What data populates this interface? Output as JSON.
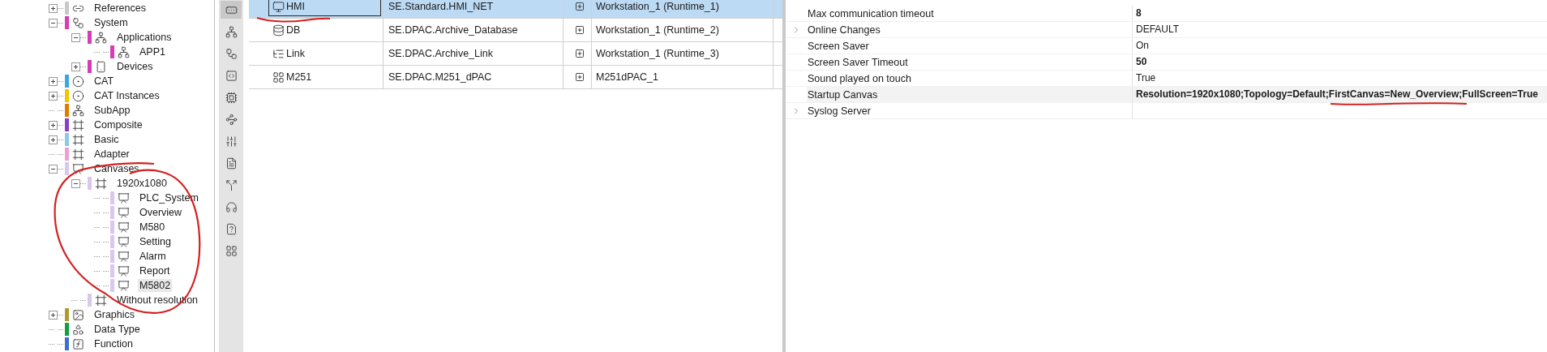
{
  "tree": [
    {
      "label": "References",
      "color": "#c8c8c8",
      "kind": "link",
      "expanded": false
    },
    {
      "label": "System",
      "color": "#d63cb4",
      "kind": "system",
      "expanded": true,
      "children": [
        {
          "label": "Applications",
          "color": "#d63cb4",
          "kind": "app",
          "expanded": true,
          "children": [
            {
              "label": "APP1",
              "color": "#d63cb4",
              "kind": "app"
            }
          ]
        },
        {
          "label": "Devices",
          "color": "#d63cb4",
          "kind": "device",
          "expanded": false
        }
      ]
    },
    {
      "label": "CAT",
      "color": "#3aa8dc",
      "kind": "cat",
      "expanded": false
    },
    {
      "label": "CAT Instances",
      "color": "#f5c400",
      "kind": "cat",
      "expanded": false
    },
    {
      "label": "SubApp",
      "color": "#e07b00",
      "kind": "app"
    },
    {
      "label": "Composite",
      "color": "#8a3fc8",
      "kind": "block",
      "expanded": false
    },
    {
      "label": "Basic",
      "color": "#8cc8e8",
      "kind": "block",
      "expanded": false
    },
    {
      "label": "Adapter",
      "color": "#f0a0d0",
      "kind": "block"
    },
    {
      "label": "Canvases",
      "color": "#d8c8ec",
      "kind": "canvas",
      "expanded": true,
      "children": [
        {
          "label": "1920x1080",
          "color": "#d8c8ec",
          "kind": "resolution",
          "expanded": true,
          "children": [
            {
              "label": "PLC_System",
              "color": "#d8c8ec",
              "kind": "canvas",
              "selected": false
            },
            {
              "label": "Overview",
              "color": "#d8c8ec",
              "kind": "canvas",
              "selected": false
            },
            {
              "label": "M580",
              "color": "#d8c8ec",
              "kind": "canvas",
              "selected": false
            },
            {
              "label": "Setting",
              "color": "#d8c8ec",
              "kind": "canvas",
              "selected": false
            },
            {
              "label": "Alarm",
              "color": "#d8c8ec",
              "kind": "canvas",
              "selected": false
            },
            {
              "label": "Report",
              "color": "#d8c8ec",
              "kind": "canvas",
              "selected": false
            },
            {
              "label": "M5802",
              "color": "#d8c8ec",
              "kind": "canvas",
              "selected": true
            }
          ]
        },
        {
          "label": "Without resolution",
          "color": "#d8c8ec",
          "kind": "resolution"
        }
      ]
    },
    {
      "label": "Graphics",
      "color": "#b09a30",
      "kind": "image",
      "expanded": false
    },
    {
      "label": "Data Type",
      "color": "#10a040",
      "kind": "datatype"
    },
    {
      "label": "Function",
      "color": "#3a70d0",
      "kind": "function"
    }
  ],
  "toolbar": [
    {
      "selected": true
    },
    {
      "selected": false
    },
    {
      "selected": false
    },
    {
      "selected": false
    },
    {
      "selected": false
    },
    {
      "selected": false
    },
    {
      "selected": false
    },
    {
      "selected": false
    },
    {
      "selected": false
    },
    {
      "selected": false
    },
    {
      "selected": false
    },
    {
      "selected": false
    }
  ],
  "table": {
    "rows": [
      {
        "kind": "hmi",
        "name": "HMI",
        "type": "SE.Standard.HMI_NET",
        "location": "Workstation_1 (Runtime_1)",
        "selected": true
      },
      {
        "kind": "db",
        "name": "DB",
        "type": "SE.DPAC.Archive_Database",
        "location": "Workstation_1 (Runtime_2)",
        "selected": false
      },
      {
        "kind": "link",
        "name": "Link",
        "type": "SE.DPAC.Archive_Link",
        "location": "Workstation_1 (Runtime_3)",
        "selected": false
      },
      {
        "kind": "module",
        "name": "M251",
        "type": "SE.DPAC.M251_dPAC",
        "location": "M251dPAC_1",
        "selected": false
      }
    ]
  },
  "properties": [
    {
      "name": "Max communication timeout",
      "value": "8",
      "bold": true,
      "expandable": false,
      "selected": false
    },
    {
      "name": "Online Changes",
      "value": "DEFAULT",
      "bold": false,
      "expandable": true,
      "selected": false
    },
    {
      "name": "Screen Saver",
      "value": "On",
      "bold": false,
      "expandable": false,
      "selected": false
    },
    {
      "name": "Screen Saver Timeout",
      "value": "50",
      "bold": true,
      "expandable": false,
      "selected": false
    },
    {
      "name": "Sound played on touch",
      "value": "True",
      "bold": false,
      "expandable": false,
      "selected": false
    },
    {
      "name": "Startup Canvas",
      "value": "Resolution=1920x1080;Topology=Default;FirstCanvas=New_Overview;FullScreen=True",
      "bold": true,
      "expandable": false,
      "selected": true
    },
    {
      "name": "Syslog Server",
      "expandable": true,
      "selected": false
    }
  ]
}
